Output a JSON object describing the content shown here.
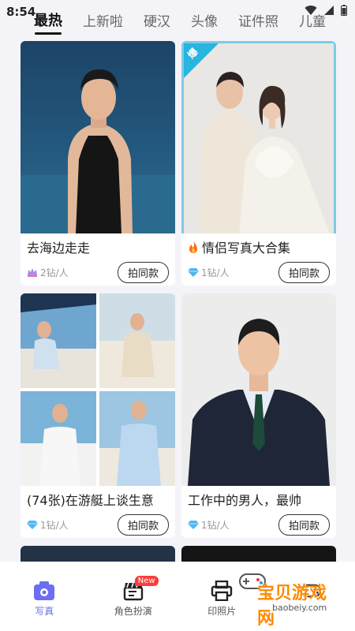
{
  "status_bar": {
    "time": "8:54"
  },
  "tabs": [
    {
      "label": "最热",
      "active": true
    },
    {
      "label": "上新啦"
    },
    {
      "label": "硬汉"
    },
    {
      "label": "头像"
    },
    {
      "label": "证件照"
    },
    {
      "label": "儿童"
    }
  ],
  "cards": [
    {
      "title": "去海边走走",
      "price": "2钻/人",
      "button": "拍同款",
      "hot": false,
      "price_icon": "crown-gem-icon"
    },
    {
      "title": "情侣写真大合集",
      "price": "1钻/人",
      "button": "拍同款",
      "hot": true,
      "badge": "爆",
      "price_icon": "diamond-icon"
    },
    {
      "title": "(74张)在游艇上谈生意",
      "price": "1钻/人",
      "button": "拍同款",
      "hot": false,
      "price_icon": "diamond-icon"
    },
    {
      "title": "工作中的男人，最帅",
      "price": "1钻/人",
      "button": "拍同款",
      "hot": false,
      "price_icon": "diamond-icon"
    }
  ],
  "bottom_nav": [
    {
      "label": "写真",
      "active": true,
      "icon": "camera-icon"
    },
    {
      "label": "角色扮演",
      "badge": "New",
      "icon": "clapperboard-icon"
    },
    {
      "label": "印照片",
      "icon": "printer-icon"
    },
    {
      "label": "",
      "icon": "gamepad-icon"
    }
  ],
  "watermark": {
    "text": "宝贝游戏网",
    "url": "baobeiy.com"
  },
  "colors": {
    "accent": "#6b6ef0",
    "hot_badge": "#2ab4e0",
    "new_badge": "#ff3b3b"
  }
}
